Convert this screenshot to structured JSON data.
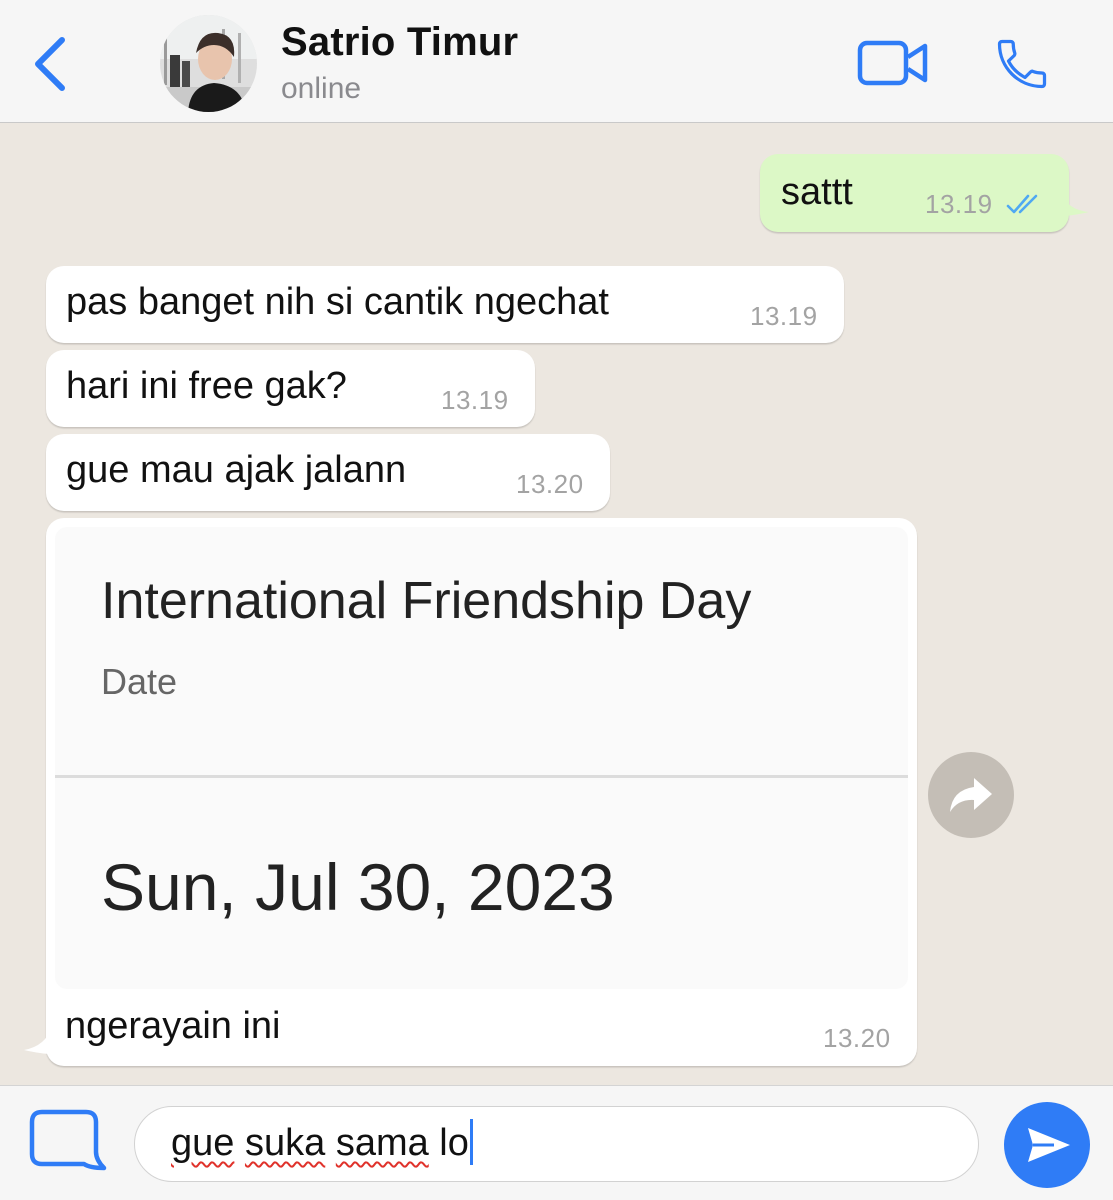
{
  "colors": {
    "accent": "#2f7cf6",
    "chat_background": "#ece7e0",
    "incoming_bubble": "#ffffff",
    "outgoing_bubble": "#dcf8c6",
    "read_ticks": "#4fa9f2",
    "spellcheck": "#e0322b"
  },
  "header": {
    "back_icon": "chevron-left-icon",
    "contact_name": "Satrio Timur",
    "status": "online",
    "video_icon": "video-camera-icon",
    "call_icon": "phone-icon"
  },
  "messages": [
    {
      "direction": "outgoing",
      "text": "sattt",
      "time": "13.19",
      "status_icon": "double-check-icon"
    },
    {
      "direction": "incoming",
      "text": "pas banget nih si cantik ngechat",
      "time": "13.19"
    },
    {
      "direction": "incoming",
      "text": "hari ini free gak?",
      "time": "13.19"
    },
    {
      "direction": "incoming",
      "text": "gue mau ajak jalann",
      "time": "13.20"
    },
    {
      "direction": "incoming",
      "card": {
        "title": "International Friendship Day",
        "subtitle": "Date",
        "date": "Sun, Jul 30, 2023"
      },
      "text": "ngerayain ini",
      "time": "13.20",
      "share_icon": "share-arrow-icon"
    }
  ],
  "composer": {
    "attach_icon": "sticker-icon",
    "value": "gue suka sama lo",
    "value_words": [
      "gue",
      "suka",
      "sama"
    ],
    "value_last": "lo",
    "send_icon": "send-icon"
  }
}
